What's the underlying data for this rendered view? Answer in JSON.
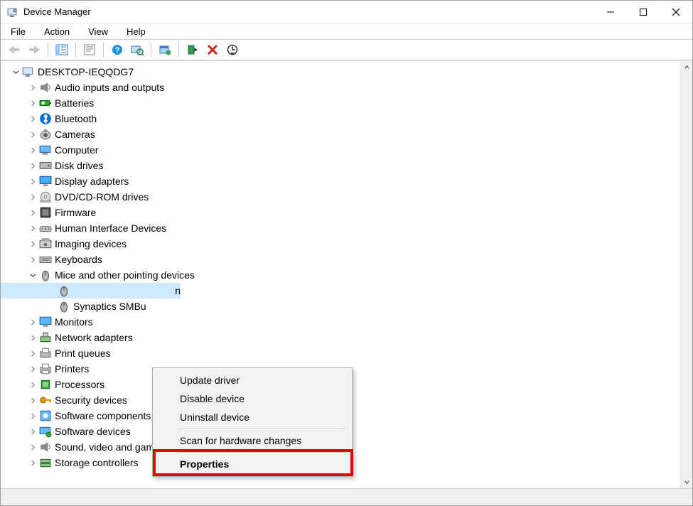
{
  "window": {
    "title": "Device Manager"
  },
  "menu": {
    "file": "File",
    "action": "Action",
    "view": "View",
    "help": "Help"
  },
  "root": {
    "name": "DESKTOP-IEQQDG7"
  },
  "nodes": [
    {
      "label": "Audio inputs and outputs",
      "icon": "speaker"
    },
    {
      "label": "Batteries",
      "icon": "battery"
    },
    {
      "label": "Bluetooth",
      "icon": "bluetooth"
    },
    {
      "label": "Cameras",
      "icon": "camera"
    },
    {
      "label": "Computer",
      "icon": "computer"
    },
    {
      "label": "Disk drives",
      "icon": "disk"
    },
    {
      "label": "Display adapters",
      "icon": "display"
    },
    {
      "label": "DVD/CD-ROM drives",
      "icon": "dvd"
    },
    {
      "label": "Firmware",
      "icon": "firmware"
    },
    {
      "label": "Human Interface Devices",
      "icon": "hid"
    },
    {
      "label": "Imaging devices",
      "icon": "imaging"
    },
    {
      "label": "Keyboards",
      "icon": "keyboard"
    },
    {
      "label": "Mice and other pointing devices",
      "icon": "mouse",
      "expanded": true
    },
    {
      "label": "Monitors",
      "icon": "monitor"
    },
    {
      "label": "Network adapters",
      "icon": "network"
    },
    {
      "label": "Print queues",
      "icon": "printqueue"
    },
    {
      "label": "Printers",
      "icon": "printer"
    },
    {
      "label": "Processors",
      "icon": "cpu"
    },
    {
      "label": "Security devices",
      "icon": "key"
    },
    {
      "label": "Software components",
      "icon": "swc"
    },
    {
      "label": "Software devices",
      "icon": "swd"
    },
    {
      "label": "Sound, video and game controllers",
      "icon": "sound"
    },
    {
      "label": "Storage controllers",
      "icon": "storage"
    }
  ],
  "mouse_children": {
    "selected": "n",
    "second": "Synaptics SMBu"
  },
  "context_menu": {
    "update": "Update driver",
    "disable": "Disable device",
    "uninstall": "Uninstall device",
    "scan": "Scan for hardware changes",
    "properties": "Properties"
  }
}
